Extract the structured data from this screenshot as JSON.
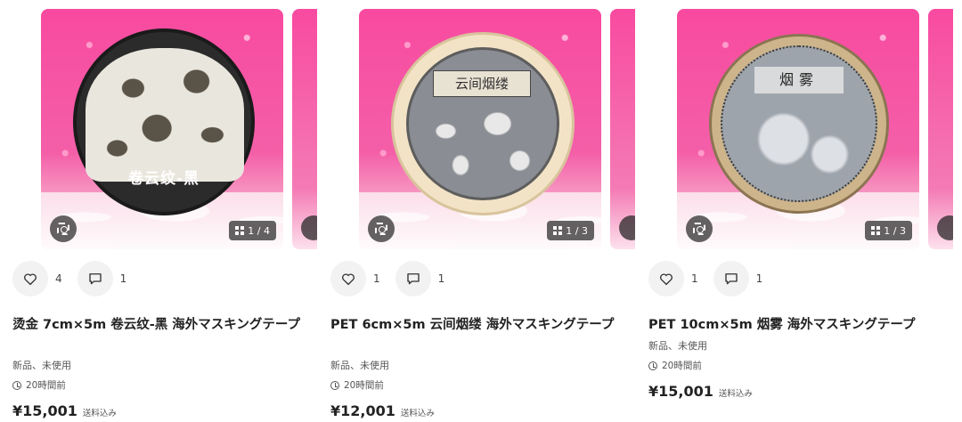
{
  "listings": [
    {
      "image_text": "卷云纹-黑",
      "image_counter": "1 / 4",
      "likes": "4",
      "comments": "1",
      "title": "烫金 7cm×5m 卷云纹-黑 海外マスキングテープ",
      "condition": "新品、未使用",
      "posted": "20時間前",
      "price": "¥15,001",
      "shipping": "送料込み"
    },
    {
      "image_text": "云间烟缕",
      "image_counter": "1 / 3",
      "likes": "1",
      "comments": "1",
      "title": "PET 6cm×5m 云间烟缕 海外マスキングテープ",
      "condition": "新品、未使用",
      "posted": "20時間前",
      "price": "¥12,001",
      "shipping": "送料込み"
    },
    {
      "image_text": "烟雾",
      "image_counter": "1 / 3",
      "likes": "1",
      "comments": "1",
      "title": "PET 10cm×5m 烟雾 海外マスキングテープ",
      "condition": "新品、未使用",
      "posted": "20時間前",
      "price": "¥15,001",
      "shipping": "送料込み"
    }
  ],
  "icons": {
    "like": "heart-icon",
    "comment": "comment-icon",
    "zoom": "image-search-icon",
    "counter": "grid-icon",
    "time": "clock-icon"
  },
  "colors": {
    "photo_background": "#f84aa0",
    "button_background": "#f2f2f2",
    "overlay": "#282828"
  }
}
